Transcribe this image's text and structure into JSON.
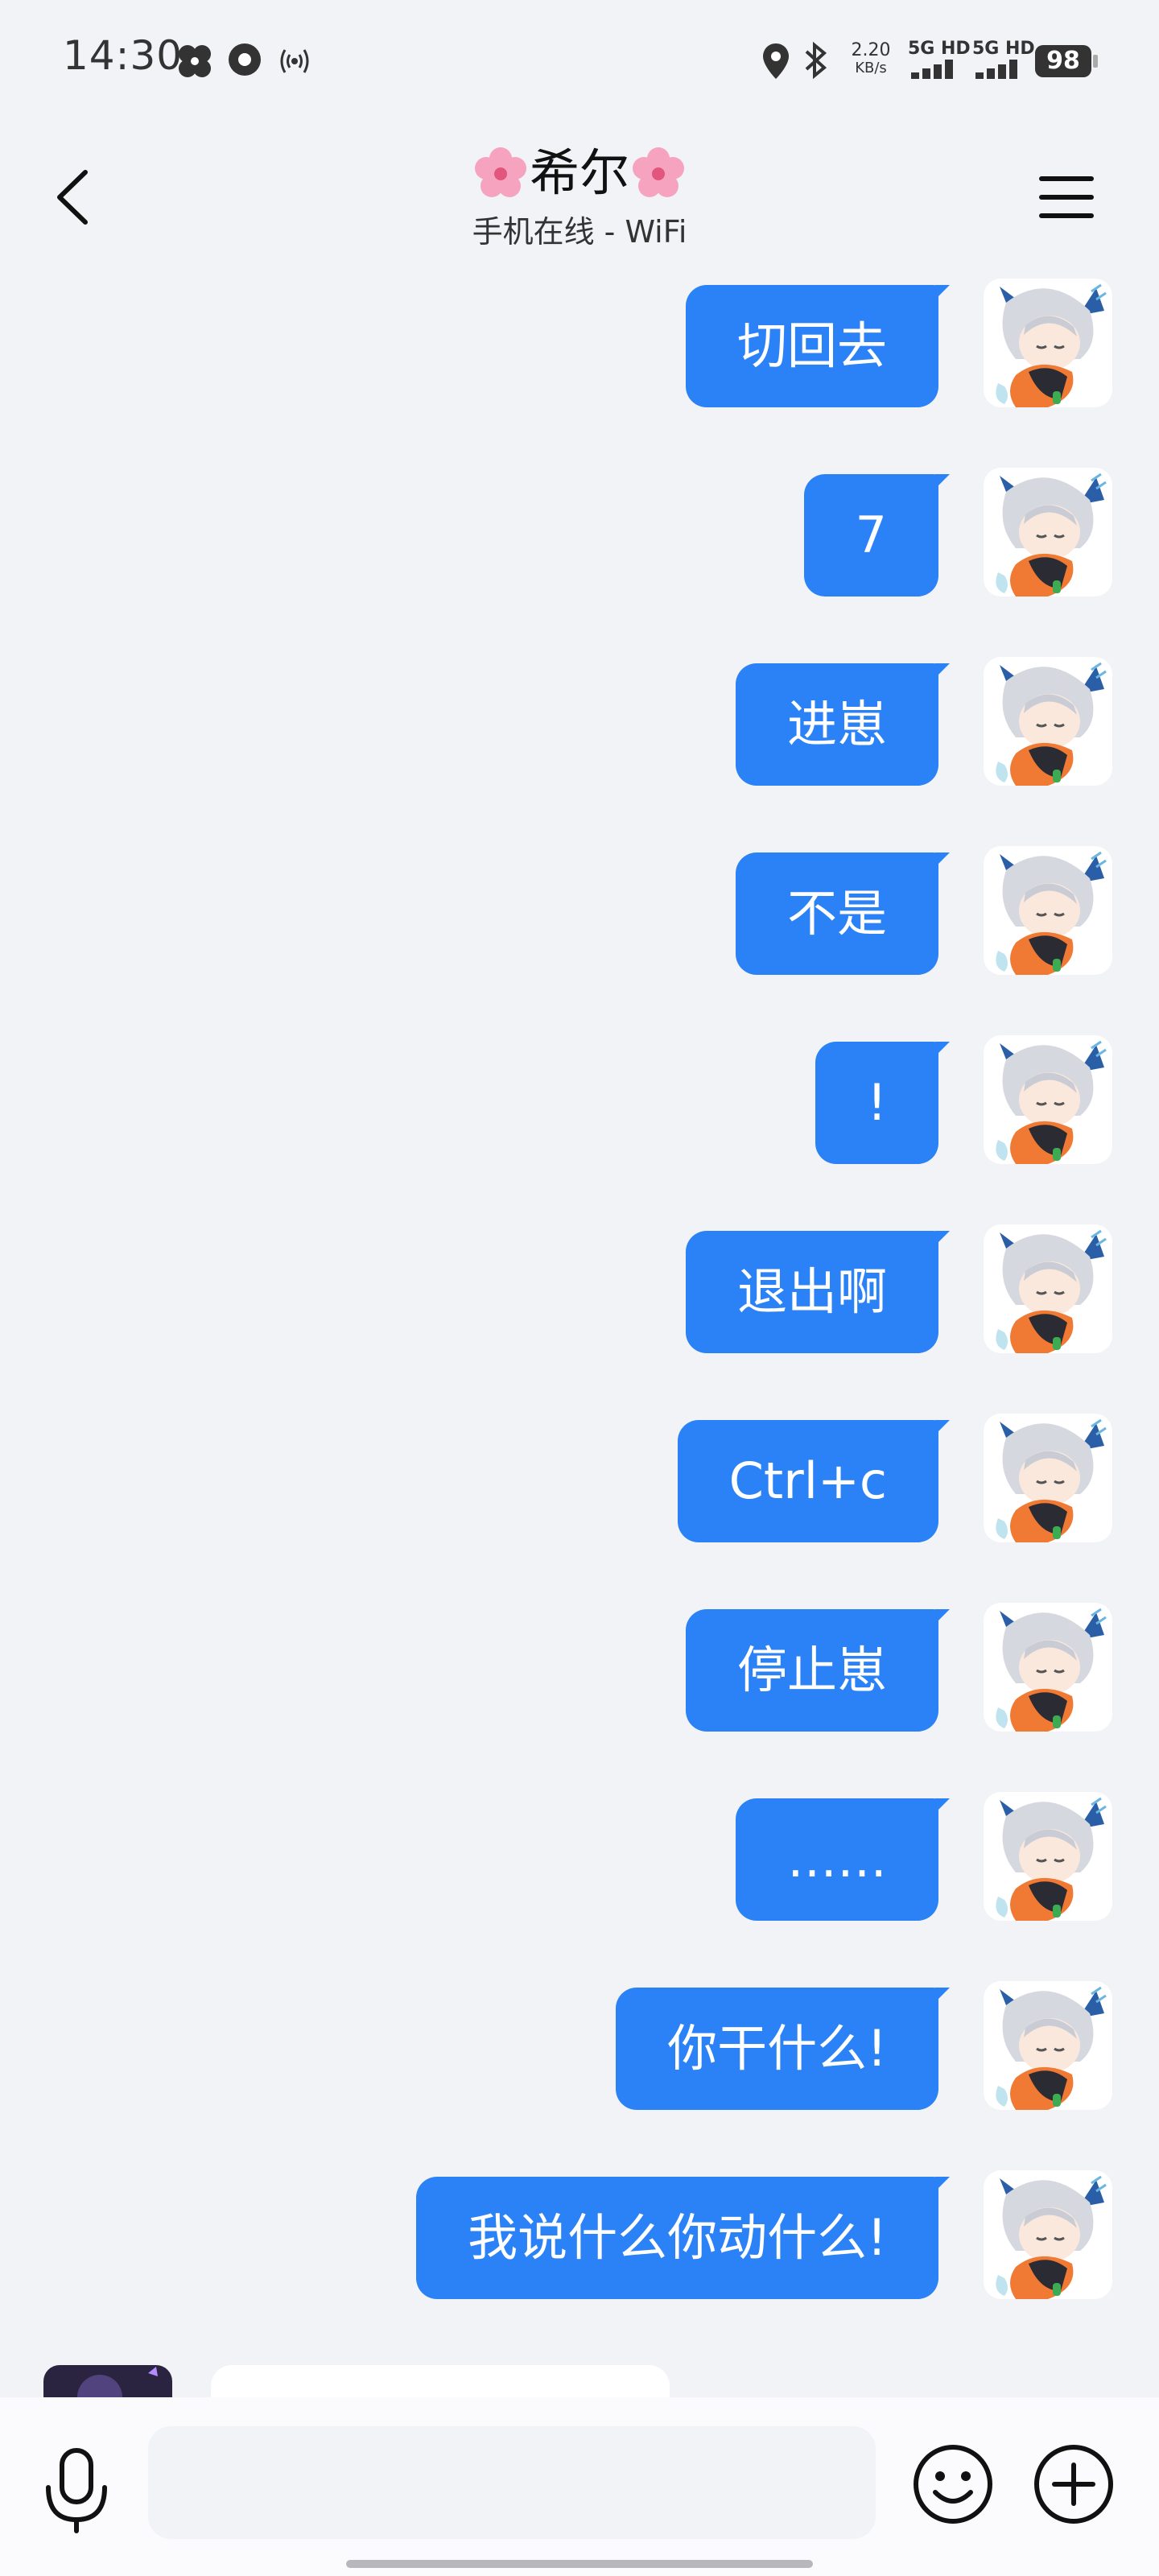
{
  "status_bar": {
    "time": "14:30",
    "net_speed_value": "2.20",
    "net_speed_unit": "KB/s",
    "sim1_label": "5G HD",
    "sim2_label": "5G HD",
    "battery": "98"
  },
  "header": {
    "back_icon": "chevron-left-icon",
    "contact_name": "希尔",
    "contact_status": "手机在线 - WiFi",
    "menu_icon": "hamburger-menu-icon"
  },
  "messages": [
    {
      "sender": "me",
      "text": "切回去"
    },
    {
      "sender": "me",
      "text": "7"
    },
    {
      "sender": "me",
      "text": "进崽"
    },
    {
      "sender": "me",
      "text": "不是"
    },
    {
      "sender": "me",
      "text": "!"
    },
    {
      "sender": "me",
      "text": "退出啊"
    },
    {
      "sender": "me",
      "text": "Ctrl+c"
    },
    {
      "sender": "me",
      "text": "停止崽"
    },
    {
      "sender": "me",
      "text": "……"
    },
    {
      "sender": "me",
      "text": "你干什么!"
    },
    {
      "sender": "me",
      "text": "我说什么你动什么!"
    }
  ],
  "input_bar": {
    "placeholder": "",
    "value": "",
    "mic_icon": "microphone-icon",
    "emoji_icon": "smiley-icon",
    "plus_icon": "plus-circle-icon"
  },
  "colors": {
    "bubble": "#2b82f6",
    "background": "#f1f3f7"
  }
}
